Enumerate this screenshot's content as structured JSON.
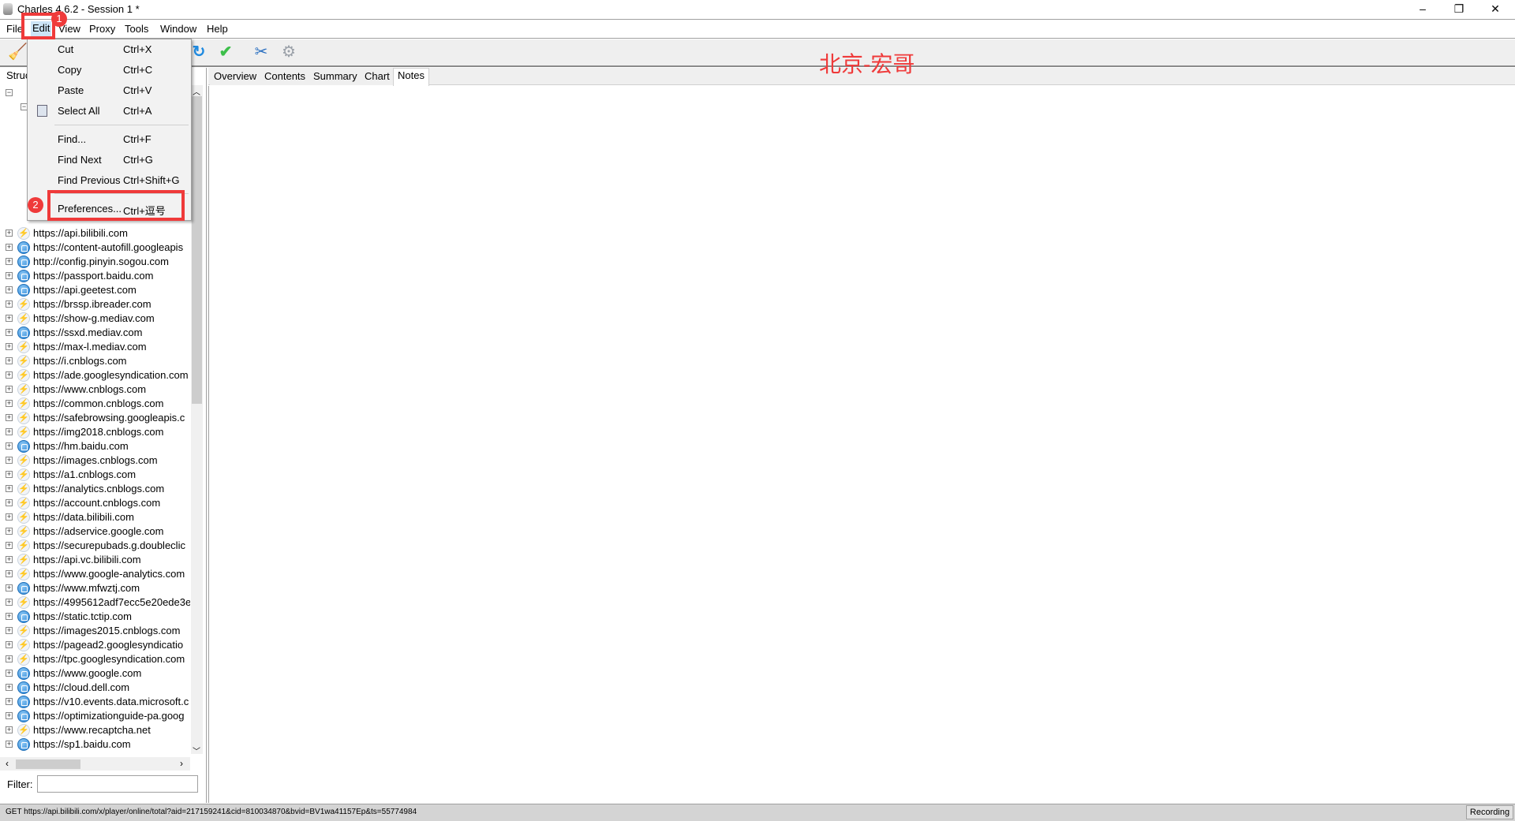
{
  "window": {
    "title": "Charles 4.6.2 - Session 1 *",
    "controls": [
      "–",
      "❐",
      "✕"
    ]
  },
  "menubar": [
    "File",
    "Edit",
    "View",
    "Proxy",
    "Tools",
    "Window",
    "Help"
  ],
  "toolbar": {
    "icons": [
      "broom-icon",
      "refresh-icon",
      "check-icon",
      "tools-icon",
      "settings-icon"
    ]
  },
  "edit_menu": {
    "items": [
      {
        "label": "Cut",
        "shortcut": "Ctrl+X"
      },
      {
        "label": "Copy",
        "shortcut": "Ctrl+C"
      },
      {
        "label": "Paste",
        "shortcut": "Ctrl+V"
      },
      {
        "label": "Select All",
        "shortcut": "Ctrl+A"
      },
      {
        "label": "Find...",
        "shortcut": "Ctrl+F"
      },
      {
        "label": "Find Next",
        "shortcut": "Ctrl+G"
      },
      {
        "label": "Find Previous",
        "shortcut": "Ctrl+Shift+G"
      },
      {
        "label": "Preferences...",
        "shortcut": "Ctrl+逗号"
      }
    ]
  },
  "annotations": {
    "badge1": "1",
    "badge2": "2",
    "color": "#ef3a3a"
  },
  "watermark": "北京-宏哥",
  "left_panel": {
    "title": "Struc",
    "filter_label": "Filter:",
    "filter_value": ""
  },
  "tree": [
    {
      "url": "https://api.bilibili.com",
      "icon": "bolt"
    },
    {
      "url": "https://content-autofill.googleapis",
      "icon": "globe"
    },
    {
      "url": "http://config.pinyin.sogou.com",
      "icon": "globe"
    },
    {
      "url": "https://passport.baidu.com",
      "icon": "globe"
    },
    {
      "url": "https://api.geetest.com",
      "icon": "globe"
    },
    {
      "url": "https://brssp.ibreader.com",
      "icon": "bolt"
    },
    {
      "url": "https://show-g.mediav.com",
      "icon": "bolt"
    },
    {
      "url": "https://ssxd.mediav.com",
      "icon": "globe"
    },
    {
      "url": "https://max-l.mediav.com",
      "icon": "bolt"
    },
    {
      "url": "https://i.cnblogs.com",
      "icon": "bolt"
    },
    {
      "url": "https://ade.googlesyndication.com",
      "icon": "bolt"
    },
    {
      "url": "https://www.cnblogs.com",
      "icon": "bolt"
    },
    {
      "url": "https://common.cnblogs.com",
      "icon": "bolt"
    },
    {
      "url": "https://safebrowsing.googleapis.c",
      "icon": "bolt"
    },
    {
      "url": "https://img2018.cnblogs.com",
      "icon": "bolt"
    },
    {
      "url": "https://hm.baidu.com",
      "icon": "globe"
    },
    {
      "url": "https://images.cnblogs.com",
      "icon": "bolt"
    },
    {
      "url": "https://a1.cnblogs.com",
      "icon": "bolt"
    },
    {
      "url": "https://analytics.cnblogs.com",
      "icon": "bolt"
    },
    {
      "url": "https://account.cnblogs.com",
      "icon": "bolt"
    },
    {
      "url": "https://data.bilibili.com",
      "icon": "bolt"
    },
    {
      "url": "https://adservice.google.com",
      "icon": "bolt"
    },
    {
      "url": "https://securepubads.g.doubleclic",
      "icon": "bolt"
    },
    {
      "url": "https://api.vc.bilibili.com",
      "icon": "bolt"
    },
    {
      "url": "https://www.google-analytics.com",
      "icon": "bolt"
    },
    {
      "url": "https://www.mfwztj.com",
      "icon": "globe"
    },
    {
      "url": "https://4995612adf7ecc5e20ede3e",
      "icon": "bolt"
    },
    {
      "url": "https://static.tctip.com",
      "icon": "globe"
    },
    {
      "url": "https://images2015.cnblogs.com",
      "icon": "bolt"
    },
    {
      "url": "https://pagead2.googlesyndicatio",
      "icon": "bolt"
    },
    {
      "url": "https://tpc.googlesyndication.com",
      "icon": "bolt"
    },
    {
      "url": "https://www.google.com",
      "icon": "globe"
    },
    {
      "url": "https://cloud.dell.com",
      "icon": "globe"
    },
    {
      "url": "https://v10.events.data.microsoft.c",
      "icon": "globe"
    },
    {
      "url": "https://optimizationguide-pa.goog",
      "icon": "globe"
    },
    {
      "url": "https://www.recaptcha.net",
      "icon": "bolt"
    },
    {
      "url": "https://sp1.baidu.com",
      "icon": "globe"
    }
  ],
  "tabs": [
    "Overview",
    "Contents",
    "Summary",
    "Chart",
    "Notes"
  ],
  "active_tab": "Notes",
  "status": {
    "text": "GET https://api.bilibili.com/x/player/online/total?aid=217159241&cid=810034870&bvid=BV1wa41157Ep&ts=55774984",
    "recording": "Recording"
  }
}
